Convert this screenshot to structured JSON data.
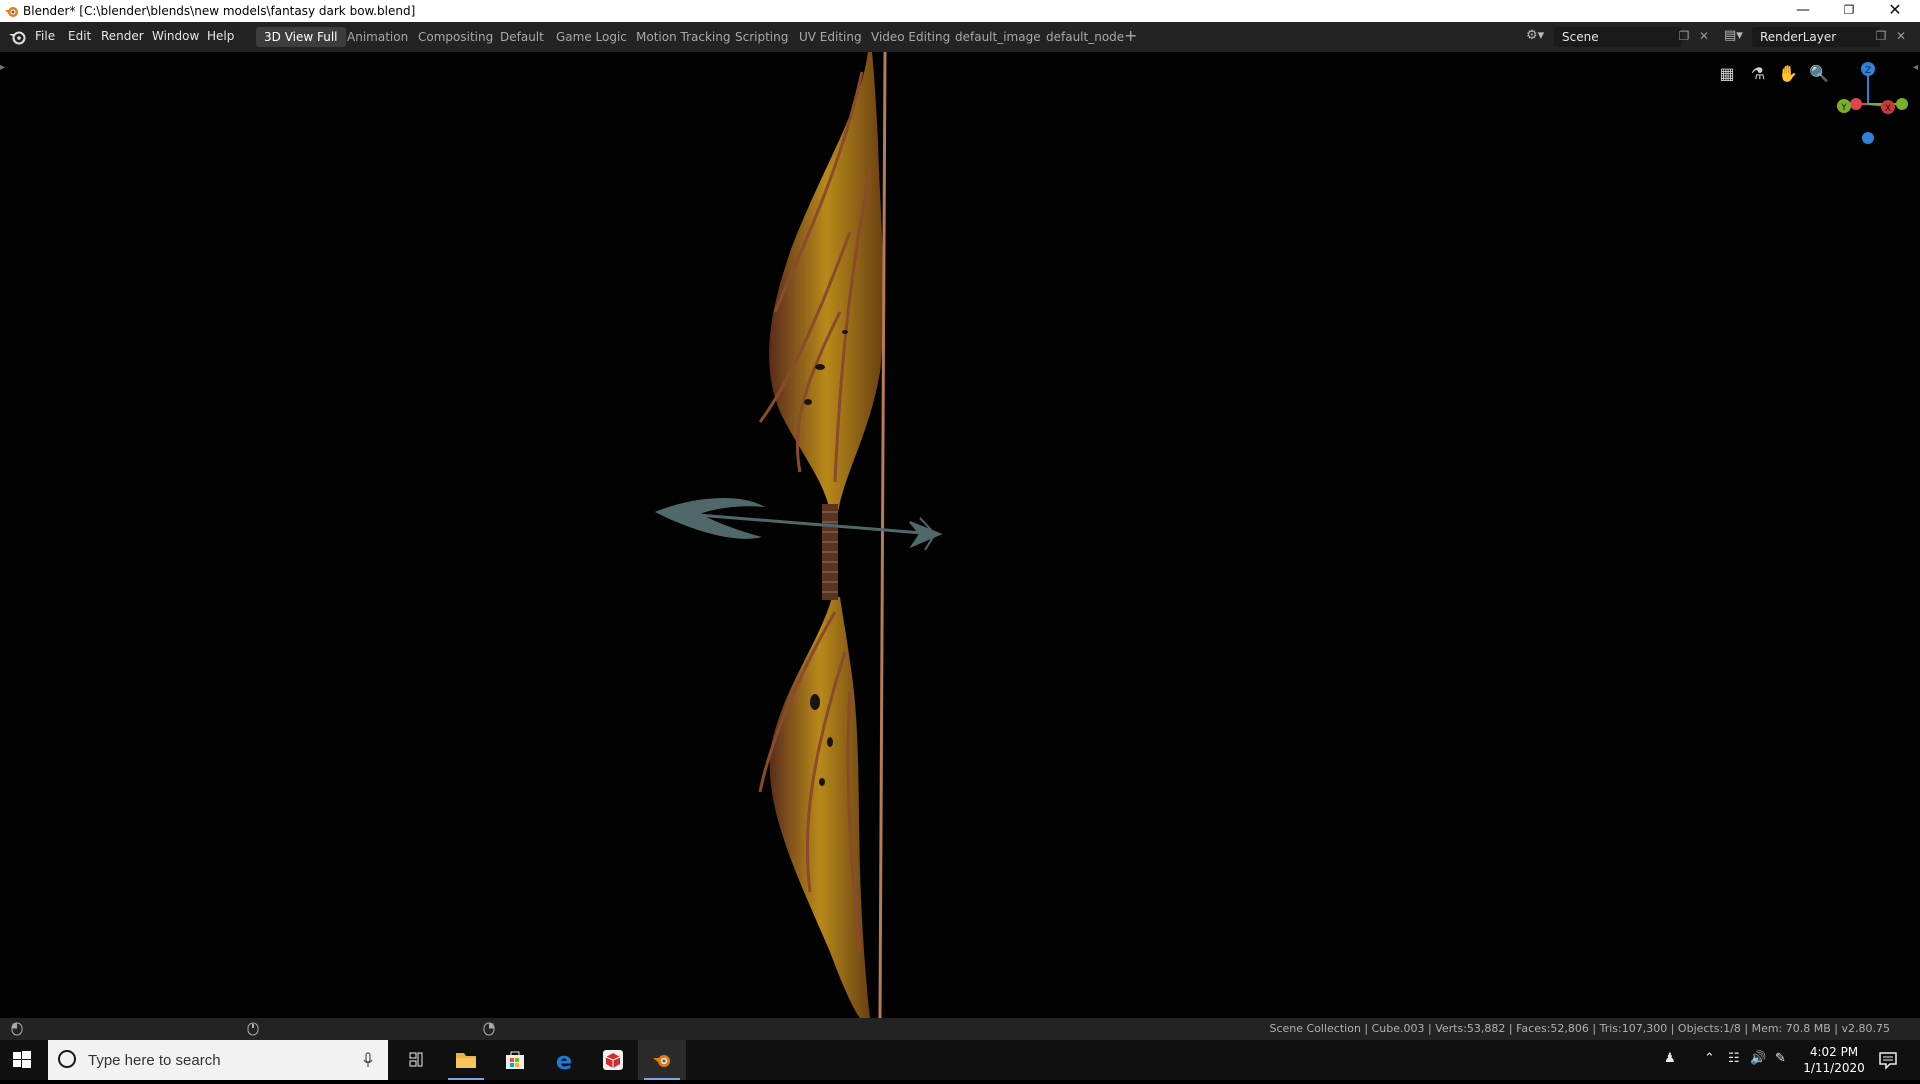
{
  "window": {
    "title": "Blender* [C:\\blender\\blends\\new models\\fantasy dark bow.blend]",
    "controls": {
      "minimize": "—",
      "restore": "❐",
      "close": "✕"
    }
  },
  "menu": {
    "items": [
      "File",
      "Edit",
      "Render",
      "Window",
      "Help"
    ]
  },
  "workspaces": {
    "tabs": [
      "3D View Full",
      "Animation",
      "Compositing",
      "Default",
      "Game Logic",
      "Motion Tracking",
      "Scripting",
      "UV Editing",
      "Video Editing",
      "default_image",
      "default_node"
    ],
    "active": "3D View Full",
    "add_label": "+"
  },
  "scene": {
    "name": "Scene"
  },
  "render_layer": {
    "name": "RenderLayer"
  },
  "gizmo": {
    "axes": {
      "z": "Z",
      "y": "Y",
      "x": "X"
    },
    "colors": {
      "x": "#e0454f",
      "y": "#7bb02a",
      "z": "#2f82d8"
    }
  },
  "statusbar": {
    "stats": "Scene Collection | Cube.003 | Verts:53,882 | Faces:52,806 | Tris:107,300 | Objects:1/8 | Mem: 70.8 MB | v2.80.75"
  },
  "taskbar": {
    "search_placeholder": "Type here to search",
    "apps": [
      "task-view",
      "file-explorer",
      "store",
      "edge",
      "app-red",
      "blender"
    ],
    "clock": {
      "time": "4:02 PM",
      "date": "1/11/2020"
    }
  },
  "colors": {
    "topbar": "#232323",
    "active_tab": "#3d3d3d",
    "viewport_bg": "#020202",
    "bow_limb": "#b88a1a",
    "bow_vein": "#8a4a2c",
    "string": "#b77b55",
    "arrow": "#51686a"
  }
}
